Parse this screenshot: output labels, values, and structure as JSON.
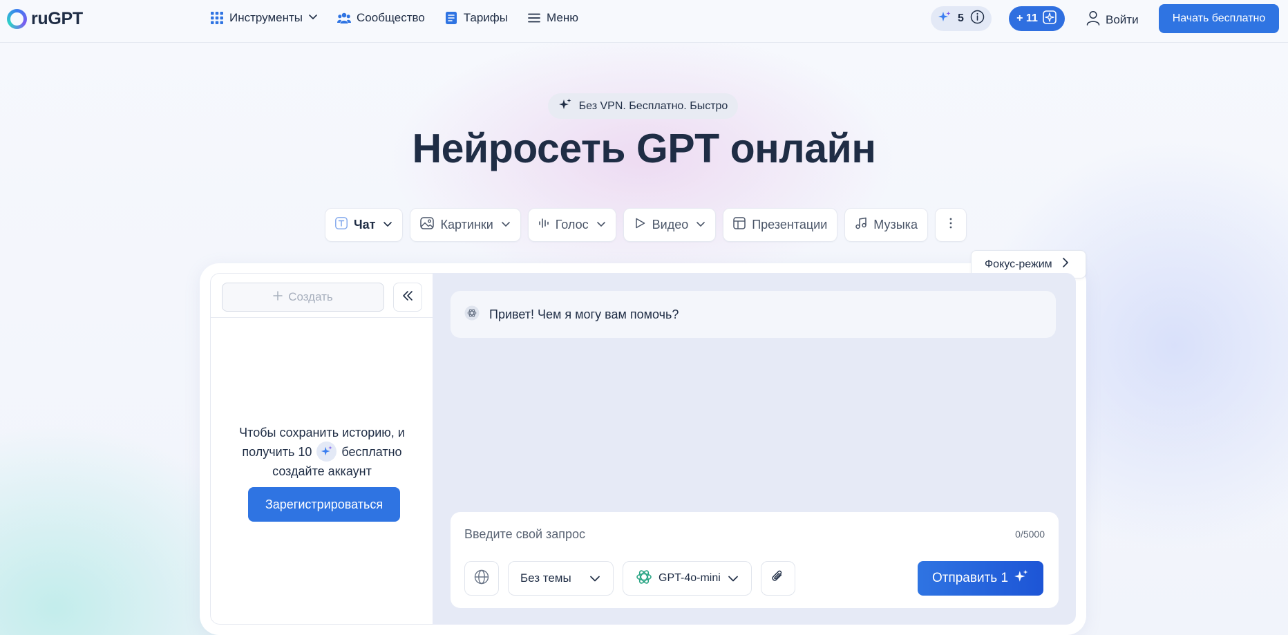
{
  "header": {
    "logo_text": "ruGPT",
    "nav": [
      {
        "label": "Инструменты",
        "icon": "grid-icon",
        "dropdown": true
      },
      {
        "label": "Сообщество",
        "icon": "community-icon"
      },
      {
        "label": "Тарифы",
        "icon": "list-icon"
      },
      {
        "label": "Меню",
        "icon": "menu-icon"
      }
    ],
    "credits_count": "5",
    "bonus_label": "+ 11",
    "login_label": "Войти",
    "start_label": "Начать бесплатно"
  },
  "hero": {
    "badge": "Без VPN. Бесплатно. Быстро",
    "title": "Нейросеть GPT онлайн",
    "tabs": [
      {
        "label": "Чат",
        "icon": "text-icon",
        "dropdown": true,
        "active": true
      },
      {
        "label": "Картинки",
        "icon": "image-icon",
        "dropdown": true
      },
      {
        "label": "Голос",
        "icon": "voice-wave-icon",
        "dropdown": true
      },
      {
        "label": "Видео",
        "icon": "play-icon",
        "dropdown": true
      },
      {
        "label": "Презентации",
        "icon": "presentation-icon"
      },
      {
        "label": "Музыка",
        "icon": "music-icon"
      }
    ]
  },
  "focus_mode_label": "Фокус-режим",
  "sidebar": {
    "create_label": "Создать",
    "message_line1": "Чтобы сохранить историю, и",
    "message_line2_pre": "получить 10",
    "message_line2_post": "бесплатно",
    "message_line3": "создайте аккаунт",
    "register_label": "Зарегистрироваться"
  },
  "chat": {
    "greeting": "Привет! Чем я могу вам помочь?",
    "input_placeholder": "Введите свой запрос",
    "counter": "0/5000",
    "theme_label": "Без темы",
    "model_label": "GPT-4o-mini",
    "send_label": "Отправить 1"
  },
  "colors": {
    "accent": "#2f74e2",
    "text": "#1f2d45",
    "chat_bg": "#e6eaf6"
  }
}
